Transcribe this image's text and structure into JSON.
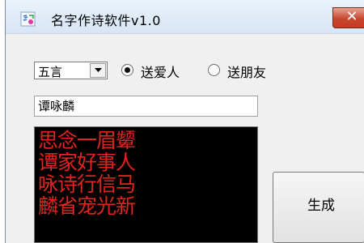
{
  "window": {
    "title": "名字作诗软件v1.0",
    "close_glyph": "✕"
  },
  "form": {
    "poem_type": {
      "selected": "五言"
    },
    "radios": [
      {
        "label": "送爱人",
        "checked": true
      },
      {
        "label": "送朋友",
        "checked": false
      }
    ],
    "name_value": "谭咏麟",
    "poem_lines": [
      "思念一眉颦",
      "谭家好事人",
      "咏诗行信马",
      "麟省宠光新"
    ],
    "generate_label": "生成"
  },
  "colors": {
    "poem_text": "#e3231d",
    "poem_bg": "#000000",
    "close_button": "#c53a22"
  },
  "icons": {
    "app": "app-icon",
    "dropdown": "chevron-down-icon"
  }
}
